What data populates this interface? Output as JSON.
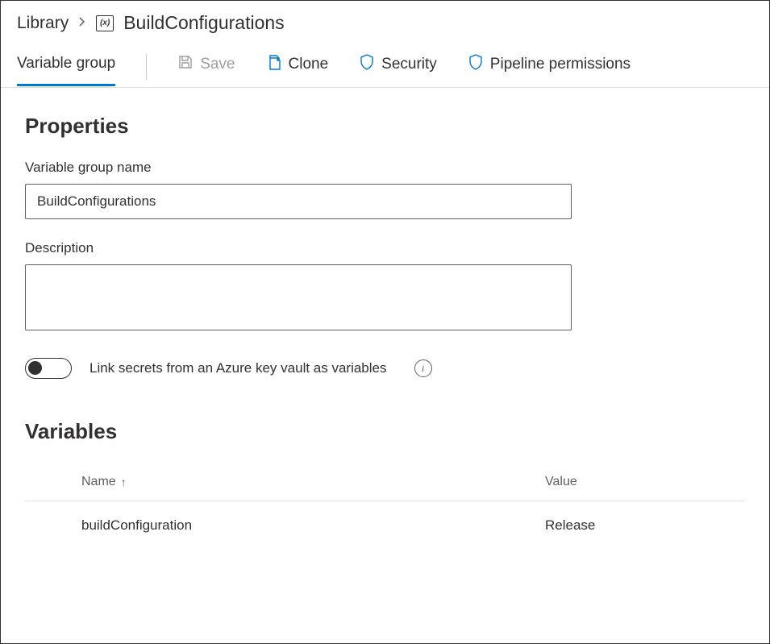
{
  "breadcrumb": {
    "root": "Library",
    "icon_label": "(x)",
    "title": "BuildConfigurations"
  },
  "toolbar": {
    "tab_label": "Variable group",
    "save_label": "Save",
    "clone_label": "Clone",
    "security_label": "Security",
    "pipeline_permissions_label": "Pipeline permissions"
  },
  "properties": {
    "section_title": "Properties",
    "name_label": "Variable group name",
    "name_value": "BuildConfigurations",
    "description_label": "Description",
    "description_value": "",
    "toggle_label": "Link secrets from an Azure key vault as variables",
    "toggle_on": false
  },
  "variables": {
    "section_title": "Variables",
    "columns": {
      "name": "Name",
      "value": "Value"
    },
    "rows": [
      {
        "name": "buildConfiguration",
        "value": "Release"
      }
    ]
  }
}
